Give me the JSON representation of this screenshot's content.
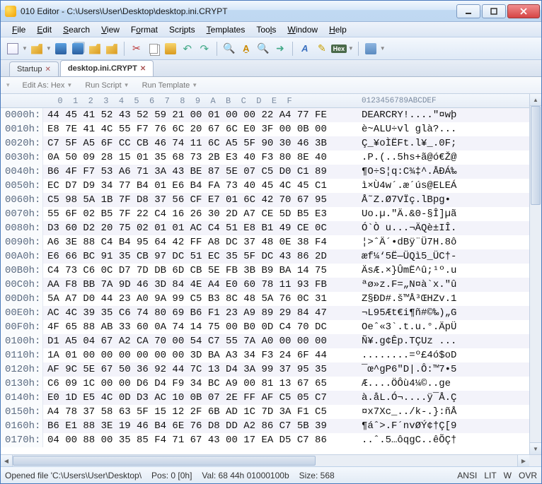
{
  "window": {
    "title": "010 Editor - C:\\Users\\User\\Desktop\\desktop.ini.CRYPT"
  },
  "menu": [
    "File",
    "Edit",
    "Search",
    "View",
    "Format",
    "Scripts",
    "Templates",
    "Tools",
    "Window",
    "Help"
  ],
  "tabs": [
    {
      "label": "Startup",
      "active": false
    },
    {
      "label": "desktop.ini.CRYPT",
      "active": true
    }
  ],
  "subtoolbar": {
    "edit_as_label": "Edit As:",
    "edit_as_value": "Hex",
    "run_script": "Run Script",
    "run_template": "Run Template"
  },
  "hex_header": {
    "bytes": "  0  1  2  3  4  5  6  7  8  9  A  B  C  D  E  F",
    "ascii": "0123456789ABCDEF"
  },
  "rows": [
    {
      "o": "0000h:",
      "b": "44 45 41 52 43 52 59 21 00 01 00 00 22 A4 77 FE",
      "a": "DEARCRY!....\"¤wþ",
      "hl": true
    },
    {
      "o": "0010h:",
      "b": "E8 7E 41 4C 55 F7 76 6C 20 67 6C E0 3F 00 0B 00",
      "a": "è~ALU÷vl glà?..."
    },
    {
      "o": "0020h:",
      "b": "C7 5F A5 6F CC CB 46 74 11 6C A5 5F 90 30 46 3B",
      "a": "Ç_¥oÌËFt.l¥_.0F;"
    },
    {
      "o": "0030h:",
      "b": "0A 50 09 28 15 01 35 68 73 2B E3 40 F3 80 8E 40",
      "a": ".P.(..5hs+ã@ó€Ž@"
    },
    {
      "o": "0040h:",
      "b": "B6 4F F7 53 A6 71 3A 43 BE 87 5E 07 C5 D0 C1 89",
      "a": "¶O÷S¦q:C¾‡^.ÅÐÁ‰"
    },
    {
      "o": "0050h:",
      "b": "EC D7 D9 34 77 B4 01 E6 B4 FA 73 40 45 4C 45 C1",
      "a": "ì×Ù4w´.æ´ús@ELEÁ"
    },
    {
      "o": "0060h:",
      "b": "C5 98 5A 1B 7F D8 37 56 CF E7 01 6C 42 70 67 95",
      "a": "Å˜Z.Ø7VÏç.lBpg•"
    },
    {
      "o": "0070h:",
      "b": "55 6F 02 B5 7F 22 C4 16 26 30 2D A7 CE 5D B5 E3",
      "a": "Uo.µ.\"Ä.&0-§Î]µã"
    },
    {
      "o": "0080h:",
      "b": "D3 60 D2 20 75 02 01 01 AC C4 51 E8 B1 49 CE 0C",
      "a": "Ó`Ò u...¬ÄQè±IÎ."
    },
    {
      "o": "0090h:",
      "b": "A6 3E 88 C4 B4 95 64 42 FF A8 DC 37 48 0E 38 F4",
      "a": "¦>ˆÄ´•dBÿ¨Ü7H.8ô"
    },
    {
      "o": "00A0h:",
      "b": "E6 66 BC 91 35 CB 97 DC 51 EC 35 5F DC 43 86 2D",
      "a": "æf¼‘5Ë—ÜQì5_ÜC†-"
    },
    {
      "o": "00B0h:",
      "b": "C4 73 C6 0C D7 7D DB 6D CB 5E FB 3B B9 BA 14 75",
      "a": "ÄsÆ.×}ÛmË^û;¹º.u"
    },
    {
      "o": "00C0h:",
      "b": "AA F8 BB 7A 9D 46 3D 84 4E A4 E0 60 78 11 93 FB",
      "a": "ªø»z.F=„N¤à`x.\"û"
    },
    {
      "o": "00D0h:",
      "b": "5A A7 D0 44 23 A0 9A 99 C5 B3 8C 48 5A 76 0C 31",
      "a": "Z§ÐD#.š™Å³ŒHZv.1"
    },
    {
      "o": "00E0h:",
      "b": "AC 4C 39 35 C6 74 80 69 B6 F1 23 A9 89 29 84 47",
      "a": "¬L95Æt€i¶ñ#©‰)„G"
    },
    {
      "o": "00F0h:",
      "b": "4F 65 88 AB 33 60 0A 74 14 75 00 B0 0D C4 70 DC",
      "a": "Oeˆ«3`.t.u.°.ÄpÜ"
    },
    {
      "o": "0100h:",
      "b": "D1 A5 04 67 A2 CA 70 00 54 C7 55 7A A0 00 00 00",
      "a": "Ñ¥.g¢Êp.TÇUz ..."
    },
    {
      "o": "0110h:",
      "b": "1A 01 00 00 00 00 00 00 3D BA A3 34 F3 24 6F 44",
      "a": "........=º£4ó$oD"
    },
    {
      "o": "0120h:",
      "b": "AF 9C 5E 67 50 36 92 44 7C 13 D4 3A 99 37 95 35",
      "a": "¯œ^gP6\"D|.Ô:™7•5"
    },
    {
      "o": "0130h:",
      "b": "C6 09 1C 00 00 D6 D4 F9 34 BC A9 00 81 13 67 65",
      "a": "Æ....ÖÔù4¼©..ge"
    },
    {
      "o": "0140h:",
      "b": "E0 1D E5 4C 0D D3 AC 10 0B 07 2E FF AF C5 05 C7",
      "a": "à.åL.Ó¬....ÿ¯Å.Ç"
    },
    {
      "o": "0150h:",
      "b": "A4 78 37 58 63 5F 15 12 2F 6B AD 1C 7D 3A F1 C5",
      "a": "¤x7Xc_../k-.}:ñÅ"
    },
    {
      "o": "0160h:",
      "b": "B6 E1 88 3E 19 46 B4 6E 76 D8 DD A2 86 C7 5B 39",
      "a": "¶áˆ>.F´nvØÝ¢†Ç[9"
    },
    {
      "o": "0170h:",
      "b": "04 00 88 00 35 85 F4 71 67 43 00 17 EA D5 C7 86",
      "a": "..ˆ.5…ôqgC..êÕÇ†"
    }
  ],
  "status": {
    "path": "Opened file 'C:\\Users\\User\\Desktop\\",
    "pos": "Pos: 0 [0h]",
    "val": "Val: 68 44h 01000100b",
    "size": "Size: 568",
    "enc": "ANSI",
    "lit": "LIT",
    "w": "W",
    "ovr": "OVR"
  }
}
